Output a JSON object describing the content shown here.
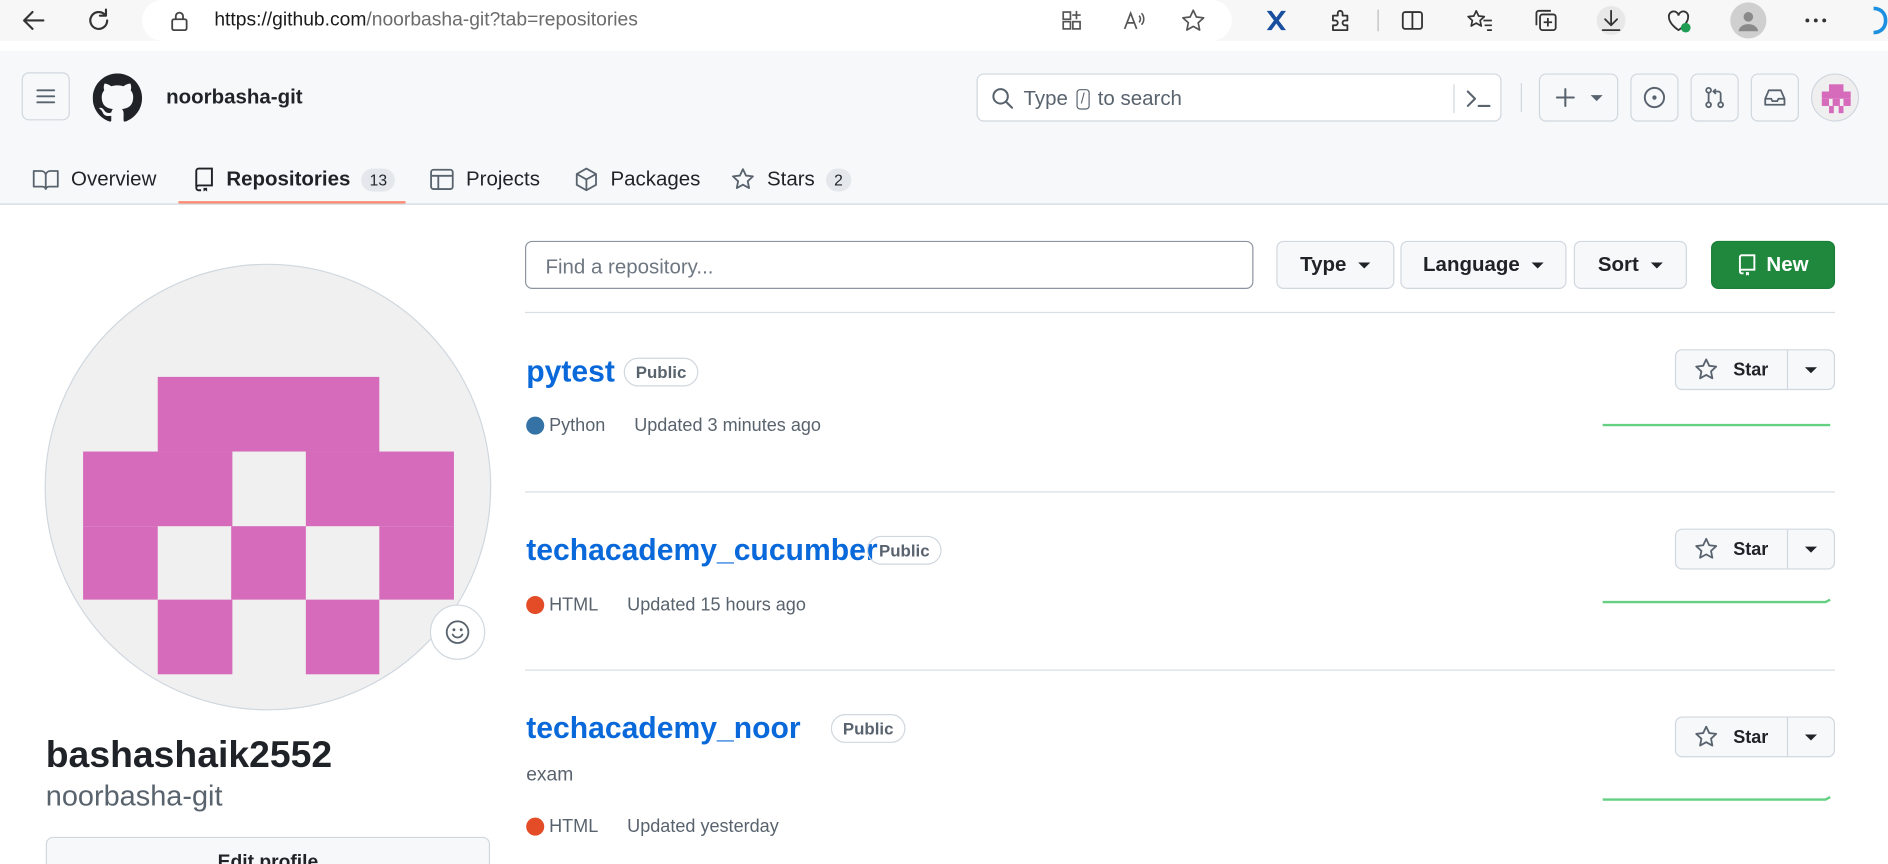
{
  "browser": {
    "url_host": "https://github.com",
    "url_path": "/noorbasha-git?tab=repositories"
  },
  "header": {
    "username": "noorbasha-git",
    "search_prefix": "Type",
    "search_key": "/",
    "search_suffix": "to search"
  },
  "tabs": [
    {
      "label": "Overview",
      "icon": "book-icon"
    },
    {
      "label": "Repositories",
      "count": "13",
      "icon": "repo-icon",
      "active": true
    },
    {
      "label": "Projects",
      "icon": "table-icon"
    },
    {
      "label": "Packages",
      "icon": "package-icon"
    },
    {
      "label": "Stars",
      "count": "2",
      "icon": "star-icon"
    }
  ],
  "profile": {
    "display_name": "bashashaik2552",
    "login": "noorbasha-git",
    "edit_label": "Edit profile",
    "avatar_color": "#d66bbb"
  },
  "filters": {
    "find_placeholder": "Find a repository...",
    "type_label": "Type",
    "language_label": "Language",
    "sort_label": "Sort",
    "new_label": "New"
  },
  "repos": [
    {
      "name": "pytest",
      "visibility": "Public",
      "description": "",
      "language": "Python",
      "language_color": "#3572A5",
      "updated": "Updated 3 minutes ago",
      "star_label": "Star"
    },
    {
      "name": "techacademy_cucumber",
      "visibility": "Public",
      "description": "",
      "language": "HTML",
      "language_color": "#e34c26",
      "updated": "Updated 15 hours ago",
      "star_label": "Star"
    },
    {
      "name": "techacademy_noor",
      "visibility": "Public",
      "description": "exam",
      "language": "HTML",
      "language_color": "#e34c26",
      "updated": "Updated yesterday",
      "star_label": "Star"
    }
  ],
  "colors": {
    "accent": "#0969da",
    "new_button": "#1f883d",
    "tab_underline": "#fd8c73",
    "sparkline": "#40c463"
  }
}
